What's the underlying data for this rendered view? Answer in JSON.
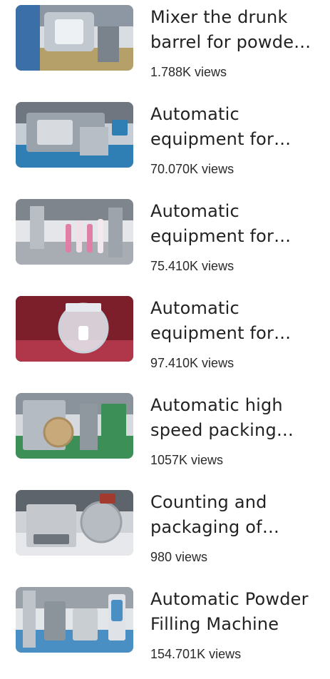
{
  "videos": [
    {
      "title": "Mixer the drunk barrel for powder mixing",
      "views": "1.788K views",
      "thumb_icon": "mixer-machine-thumbnail",
      "palette": [
        "#8d97a3",
        "#d9dde2",
        "#3b6fa8",
        "#b5a06a"
      ]
    },
    {
      "title": "Automatic equipment for tube filling",
      "views": "70.070K views",
      "thumb_icon": "filling-machine-thumbnail",
      "palette": [
        "#6f7680",
        "#c7cdd4",
        "#9a4a3a",
        "#2f7fb5"
      ]
    },
    {
      "title": "Automatic equipment for tube sealing",
      "views": "75.410K views",
      "thumb_icon": "tube-sealing-thumbnail",
      "palette": [
        "#7f858d",
        "#e4e6ea",
        "#e07fa6",
        "#a8adb3"
      ]
    },
    {
      "title": "Automatic equipment for tablet testing",
      "views": "97.410K views",
      "thumb_icon": "tablet-tester-thumbnail",
      "palette": [
        "#7d1f2b",
        "#dfe3e8",
        "#b0364a",
        "#9aa3ad"
      ]
    },
    {
      "title": "Automatic high speed packing machine",
      "views": "1057K views",
      "thumb_icon": "packing-machine-thumbnail",
      "palette": [
        "#8a929b",
        "#d6dadf",
        "#c8a97a",
        "#3b8f57"
      ]
    },
    {
      "title": "Counting and packaging of capsules",
      "views": "980 views",
      "thumb_icon": "counting-machine-thumbnail",
      "palette": [
        "#5e646b",
        "#cfd3d8",
        "#a33a30",
        "#e6e8eb"
      ]
    },
    {
      "title": "Automatic Powder Filling Machine",
      "views": "154.701K views",
      "thumb_icon": "powder-filling-thumbnail",
      "palette": [
        "#9aa1a8",
        "#e3e6e9",
        "#6c737b",
        "#4a8fc4"
      ]
    }
  ]
}
